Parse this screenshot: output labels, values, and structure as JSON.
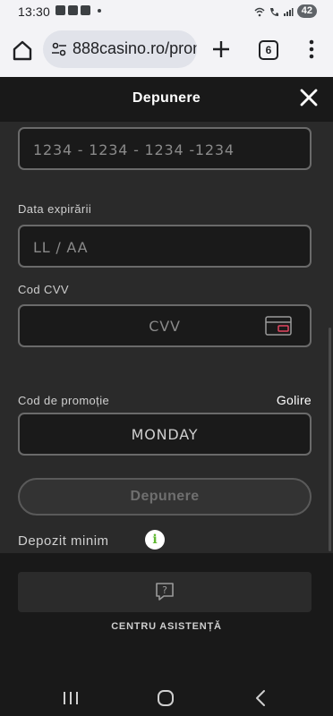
{
  "status_bar": {
    "time": "13:30",
    "battery": "42"
  },
  "browser": {
    "url": "888casino.ro/prom",
    "tab_count": "6"
  },
  "modal": {
    "title": "Depunere"
  },
  "form": {
    "card_number_placeholder": "1234 - 1234 - 1234 -1234",
    "expiry_label": "Data expirării",
    "expiry_placeholder": "LL / AA",
    "cvv_label": "Cod CVV",
    "cvv_placeholder": "CVV",
    "promo_label": "Cod de promoție",
    "promo_clear": "Golire",
    "promo_value": "MONDAY",
    "submit_label": "Depunere",
    "min_deposit_label": "Depozit minim",
    "info_glyph": "i"
  },
  "support": {
    "label": "CENTRU ASISTENȚĂ"
  },
  "colors": {
    "accent_green": "#5fb832",
    "card_icon_red": "#e2455f",
    "background": "#2a2a2a"
  }
}
